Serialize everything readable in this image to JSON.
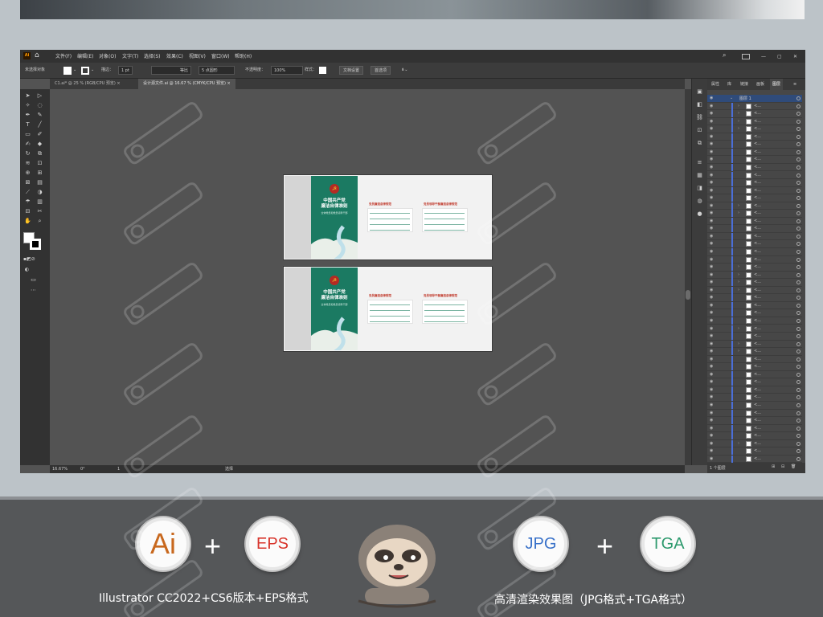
{
  "menubar": {
    "app_logo": "Ai",
    "items": [
      "文件(F)",
      "编辑(E)",
      "对象(O)",
      "文字(T)",
      "选择(S)",
      "效果(C)",
      "视图(V)",
      "窗口(W)",
      "帮助(H)"
    ]
  },
  "control_bar": {
    "selection": "未选择对象",
    "stroke_label": "描边：",
    "stroke_value": "1 pt",
    "stroke_style": "等比",
    "brush": "5 点圆形",
    "opacity_label": "不透明度：",
    "opacity_value": "100%",
    "style_label": "样式：",
    "doc_setup": "文档设置",
    "preferences": "首选项"
  },
  "tabs": [
    {
      "label": "C1.ai* @ 25 % (RGB/CPU 预览)",
      "close": "×"
    },
    {
      "label": "设计源文件.ai @ 16.67 % (CMYK/CPU 预览)",
      "close": "×"
    }
  ],
  "panel": {
    "tabs": [
      "属性",
      "库",
      "链接",
      "画板",
      "图层"
    ],
    "layer_name": "图层 1",
    "row_label": "<...",
    "footer": "1 个图层"
  },
  "status": {
    "zoom": "16.67%",
    "rotation": "0°",
    "artboard": "1",
    "tool": "选择"
  },
  "artboard": {
    "title_line1": "中国共产党",
    "title_line2": "廉洁自律准则",
    "subtitle": "全体党员和党员领导干部",
    "col1_title": "党员廉洁自律规范",
    "col2_title": "党员领导干部廉洁自律规范",
    "emblem": "☭"
  },
  "badges": {
    "ai": "Ai",
    "eps": "EPS",
    "jpg": "JPG",
    "tga": "TGA",
    "plus": "+"
  },
  "captions": {
    "left": "Illustrator CC2022+CS6版本+EPS格式",
    "right": "高清渲染效果图（JPG格式+TGA格式）"
  },
  "colors": {
    "ai_orange": "#c8681e",
    "eps_red": "#d8352c",
    "jpg_blue": "#3a72c9",
    "tga_green": "#2e9a6e",
    "artboard_green": "#1b7a62"
  }
}
